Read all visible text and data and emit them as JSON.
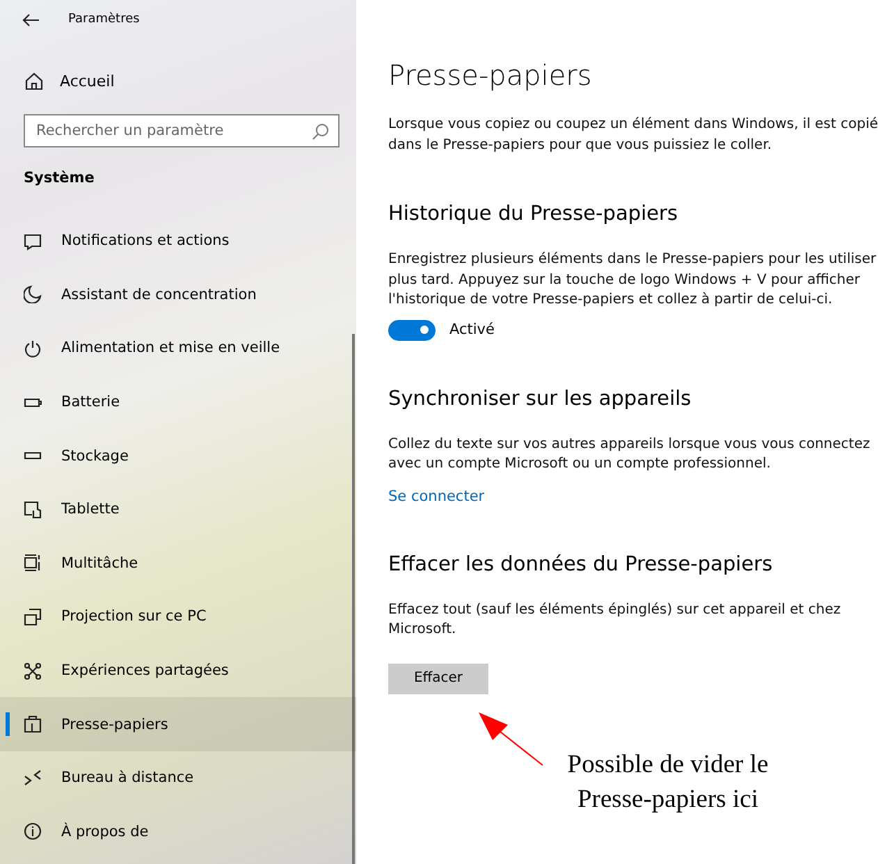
{
  "window": {
    "title": "Paramètres"
  },
  "sidebar": {
    "home": "Accueil",
    "search": {
      "placeholder": "Rechercher un paramètre"
    },
    "section": "Système",
    "items": [
      {
        "label": "Notifications et actions",
        "selected": false
      },
      {
        "label": "Assistant de concentration",
        "selected": false
      },
      {
        "label": "Alimentation et mise en veille",
        "selected": false
      },
      {
        "label": "Batterie",
        "selected": false
      },
      {
        "label": "Stockage",
        "selected": false
      },
      {
        "label": "Tablette",
        "selected": false
      },
      {
        "label": "Multitâche",
        "selected": false
      },
      {
        "label": "Projection sur ce PC",
        "selected": false
      },
      {
        "label": "Expériences partagées",
        "selected": false
      },
      {
        "label": "Presse-papiers",
        "selected": true
      },
      {
        "label": "Bureau à distance",
        "selected": false
      },
      {
        "label": "À propos de",
        "selected": false
      }
    ]
  },
  "page": {
    "title": "Presse-papiers",
    "intro": "Lorsque vous copiez ou coupez un élément dans Windows, il est copié dans le Presse-papiers pour que vous puissiez le coller.",
    "sections": [
      {
        "kind": "toggle",
        "heading": "Historique du Presse-papiers",
        "text": "Enregistrez plusieurs éléments dans le Presse-papiers pour les utiliser plus tard. Appuyez sur la touche de logo Windows + V pour afficher l'historique de votre Presse-papiers et collez à partir de celui-ci.",
        "on": true,
        "label": "Activé"
      },
      {
        "kind": "link",
        "heading": "Synchroniser sur les appareils",
        "text": "Collez du texte sur vos autres appareils lorsque vous vous connectez avec un compte Microsoft ou un compte professionnel.",
        "label": "Se connecter"
      },
      {
        "kind": "button",
        "heading": "Effacer les données du Presse-papiers",
        "text": "Effacez tout (sauf les éléments épinglés) sur cet appareil et chez Microsoft.",
        "label": "Effacer"
      }
    ]
  },
  "annotation": {
    "text": "Possible de vider le Presse-papiers ici"
  }
}
